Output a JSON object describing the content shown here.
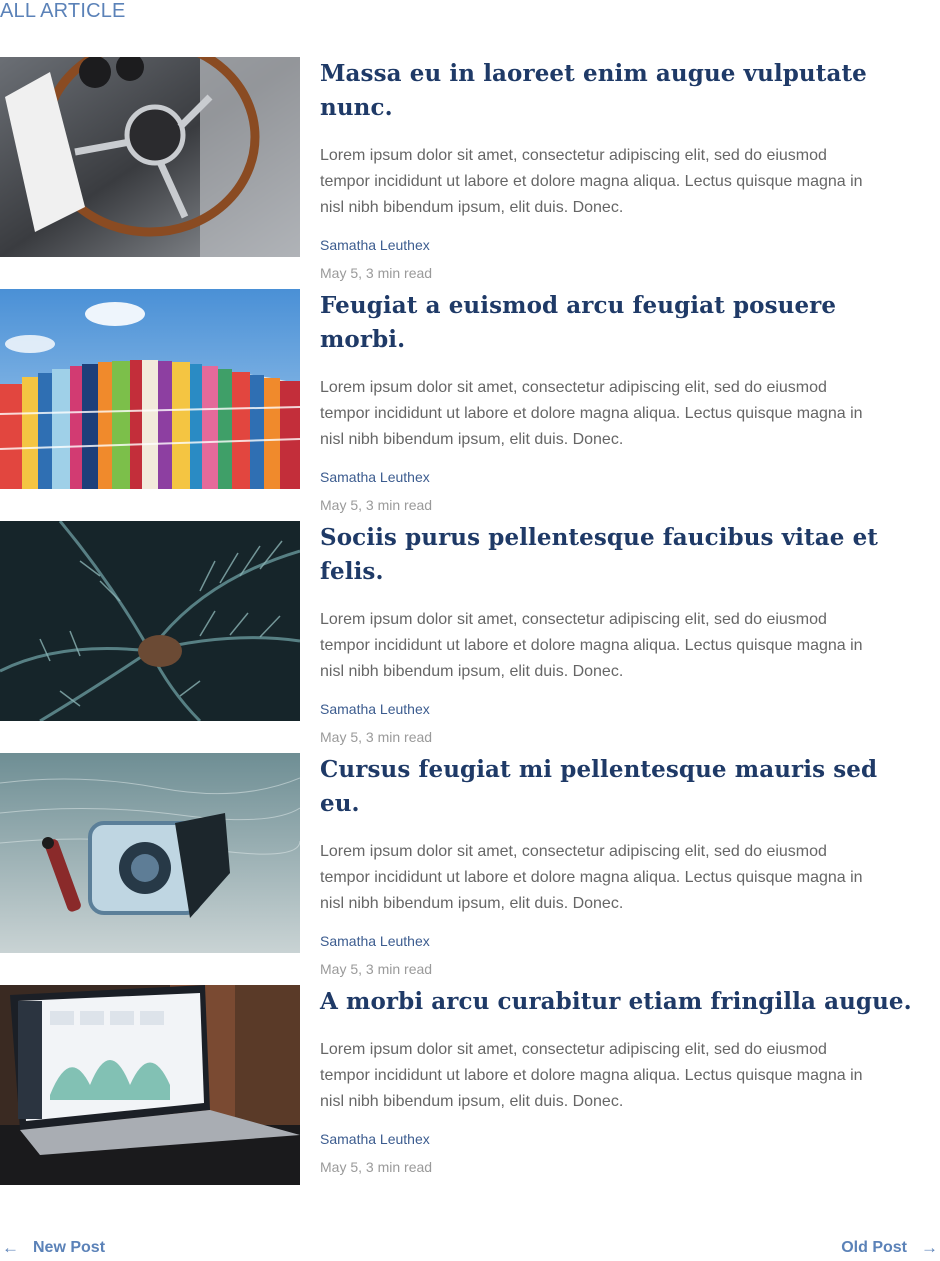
{
  "section_title": "ALL ARTICLE",
  "articles": [
    {
      "title": "Massa eu in laoreet enim augue vulputate nunc.",
      "excerpt": "Lorem ipsum dolor sit amet, consectetur adipiscing elit, sed do eiusmod tempor incididunt ut labore et dolore magna aliqua. Lectus quisque magna in nisl nibh bibendum ipsum, elit duis. Donec.",
      "author": "Samatha Leuthex",
      "meta": "May 5, 3 min read"
    },
    {
      "title": "Feugiat a euismod arcu feugiat posuere morbi.",
      "excerpt": "Lorem ipsum dolor sit amet, consectetur adipiscing elit, sed do eiusmod tempor incididunt ut labore et dolore magna aliqua. Lectus quisque magna in nisl nibh bibendum ipsum, elit duis. Donec.",
      "author": "Samatha Leuthex",
      "meta": "May 5, 3 min read"
    },
    {
      "title": "Sociis purus pellentesque faucibus vitae et felis.",
      "excerpt": "Lorem ipsum dolor sit amet, consectetur adipiscing elit, sed do eiusmod tempor incididunt ut labore et dolore magna aliqua. Lectus quisque magna in nisl nibh bibendum ipsum, elit duis. Donec.",
      "author": "Samatha Leuthex",
      "meta": "May 5, 3 min read"
    },
    {
      "title": "Cursus feugiat mi pellentesque mauris sed eu.",
      "excerpt": "Lorem ipsum dolor sit amet, consectetur adipiscing elit, sed do eiusmod tempor incididunt ut labore et dolore magna aliqua. Lectus quisque magna in nisl nibh bibendum ipsum, elit duis. Donec.",
      "author": "Samatha Leuthex",
      "meta": "May 5, 3 min read"
    },
    {
      "title": "A morbi arcu curabitur etiam fringilla augue.",
      "excerpt": "Lorem ipsum dolor sit amet, consectetur adipiscing elit, sed do eiusmod tempor incididunt ut labore et dolore magna aliqua. Lectus quisque magna in nisl nibh bibendum ipsum, elit duis. Donec.",
      "author": "Samatha Leuthex",
      "meta": "May 5, 3 min read"
    }
  ],
  "pager": {
    "prev_label": "New Post",
    "next_label": "Old Post",
    "prev_icon": "arrow-left-icon",
    "next_icon": "arrow-right-icon"
  },
  "colors": {
    "accent": "#5b82b8",
    "headline": "#1f3a67",
    "author": "#3c5c8f",
    "meta": "#9a9a9a"
  }
}
